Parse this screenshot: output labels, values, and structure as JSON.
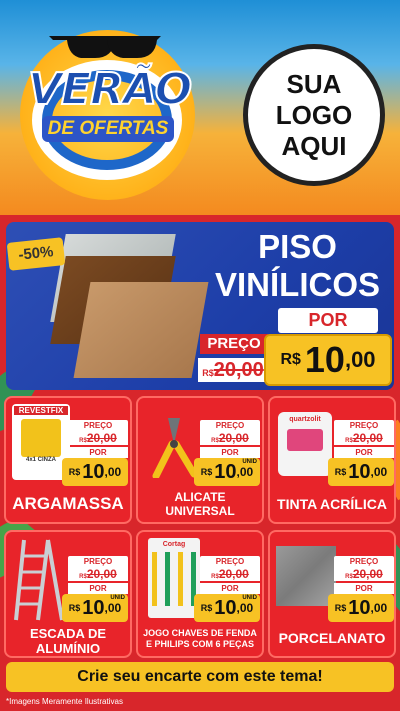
{
  "header": {
    "title_main": "VERÃO",
    "title_sub": "DE OFERTAS",
    "logo_lines": [
      "SUA",
      "LOGO",
      "AQUI"
    ]
  },
  "featured": {
    "discount": "-50%",
    "title_lines": [
      "PISO",
      "VINÍLICOS"
    ],
    "preco_label": "PREÇO",
    "por_label": "POR",
    "currency": "R$",
    "old_price": "20,00",
    "new_price_int": "10",
    "new_price_dec": ",00"
  },
  "products": [
    {
      "name": "ARGAMASSA",
      "preco_label": "PREÇO",
      "old_price": "20,00",
      "por_label": "POR",
      "currency": "R$",
      "new_int": "10",
      "new_dec": ",00",
      "unit": "",
      "brand_text": "REVESTFIX",
      "pack_text": "4x1 CINZA"
    },
    {
      "name_lines": [
        "ALICATE",
        "UNIVERSAL"
      ],
      "preco_label": "PREÇO",
      "old_price": "20,00",
      "por_label": "POR",
      "currency": "R$",
      "new_int": "10",
      "new_dec": ",00",
      "unit": "UNID"
    },
    {
      "name": "TINTA ACRÍLICA",
      "preco_label": "PREÇO",
      "old_price": "20,00",
      "por_label": "POR",
      "currency": "R$",
      "new_int": "10",
      "new_dec": ",00",
      "unit": "",
      "brand_text": "quartzolit"
    },
    {
      "name_lines": [
        "ESCADA DE",
        "ALUMÍNIO"
      ],
      "preco_label": "PREÇO",
      "old_price": "20,00",
      "por_label": "POR",
      "currency": "R$",
      "new_int": "10",
      "new_dec": ",00",
      "unit": "UNID"
    },
    {
      "name_lines": [
        "JOGO CHAVES DE FENDA",
        "E PHILIPS COM 6 PEÇAS"
      ],
      "preco_label": "PREÇO",
      "old_price": "20,00",
      "por_label": "POR",
      "currency": "R$",
      "new_int": "10",
      "new_dec": ",00",
      "unit": "UNID",
      "brand_text": "Cortag"
    },
    {
      "name": "PORCELANATO",
      "preco_label": "PREÇO",
      "old_price": "20,00",
      "por_label": "POR",
      "currency": "R$",
      "new_int": "10",
      "new_dec": ",00",
      "unit": ""
    }
  ],
  "cta": "Crie seu encarte com este tema!",
  "footnote": "*Imagens Meramente Ilustrativas",
  "colors": {
    "red": "#d8262b",
    "yellow": "#f7c224",
    "blue": "#2e4fb5"
  }
}
